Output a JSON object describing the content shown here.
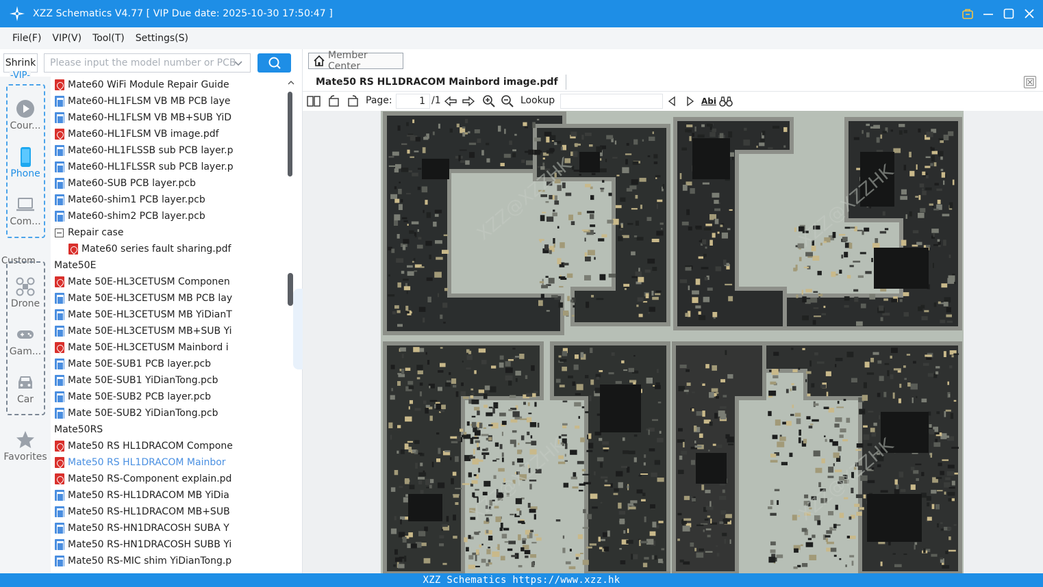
{
  "window": {
    "title": "XZZ Schematics V4.77 [ VIP Due date: 2025-10-30 17:50:47 ]",
    "accent": "#1e8ee6"
  },
  "menu": [
    "File(F)",
    "VIP(V)",
    "Tool(T)",
    "Settings(S)"
  ],
  "sidebar": {
    "shrink_label": "Shrink",
    "search_placeholder": "Please input the model number or PCB",
    "vip_label": "VIP",
    "custom_label": "Custom",
    "categories": [
      {
        "label": "Cour...",
        "icon": "play-icon"
      },
      {
        "label": "Phone",
        "icon": "phone-icon"
      },
      {
        "label": "Com...",
        "icon": "laptop-icon"
      },
      {
        "label": "Drone",
        "icon": "drone-icon"
      },
      {
        "label": "Gam...",
        "icon": "gamepad-icon"
      },
      {
        "label": "Car",
        "icon": "car-icon"
      },
      {
        "label": "Favorites",
        "icon": "star-icon"
      }
    ],
    "active_category": "Phone"
  },
  "tree": [
    {
      "type": "pdf",
      "level": 2,
      "label": "Mate60 WiFi Module Repair Guide"
    },
    {
      "type": "pcb",
      "level": 2,
      "label": "Mate60-HL1FLSM VB MB PCB laye"
    },
    {
      "type": "pcb",
      "level": 2,
      "label": "Mate60-HL1FLSM VB MB+SUB YiD"
    },
    {
      "type": "pdf",
      "level": 2,
      "label": "Mate60-HL1FLSM VB image.pdf"
    },
    {
      "type": "pcb",
      "level": 2,
      "label": "Mate60-HL1FLSSB sub PCB layer.p"
    },
    {
      "type": "pcb",
      "level": 2,
      "label": "Mate60-HL1FLSSR sub PCB layer.p"
    },
    {
      "type": "pcb",
      "level": 2,
      "label": "Mate60-SUB PCB layer.pcb"
    },
    {
      "type": "pcb",
      "level": 2,
      "label": "Mate60-shim1 PCB layer.pcb"
    },
    {
      "type": "pcb",
      "level": 2,
      "label": "Mate60-shim2 PCB layer.pcb"
    },
    {
      "type": "folder",
      "level": 2,
      "label": "Repair case"
    },
    {
      "type": "pdf",
      "level": 3,
      "label": "Mate60 series fault sharing.pdf"
    },
    {
      "type": "folder",
      "level": 1,
      "label": "Mate50E"
    },
    {
      "type": "pdf",
      "level": 2,
      "label": "Mate 50E-HL3CETUSM Componen"
    },
    {
      "type": "pcb",
      "level": 2,
      "label": "Mate 50E-HL3CETUSM MB PCB lay"
    },
    {
      "type": "pcb",
      "level": 2,
      "label": "Mate 50E-HL3CETUSM MB YiDianT"
    },
    {
      "type": "pcb",
      "level": 2,
      "label": "Mate 50E-HL3CETUSM MB+SUB Yi"
    },
    {
      "type": "pdf",
      "level": 2,
      "label": "Mate 50E-HL3CETUSM Mainbord i"
    },
    {
      "type": "pcb",
      "level": 2,
      "label": "Mate 50E-SUB1 PCB layer.pcb"
    },
    {
      "type": "pcb",
      "level": 2,
      "label": "Mate 50E-SUB1 YiDianTong.pcb"
    },
    {
      "type": "pcb",
      "level": 2,
      "label": "Mate 50E-SUB2 PCB layer.pcb"
    },
    {
      "type": "pcb",
      "level": 2,
      "label": "Mate 50E-SUB2 YiDianTong.pcb"
    },
    {
      "type": "folder",
      "level": 1,
      "label": "Mate50RS"
    },
    {
      "type": "pdf",
      "level": 2,
      "label": "Mate50 RS HL1DRACOM Compone"
    },
    {
      "type": "pdf",
      "level": 2,
      "label": "Mate50 RS HL1DRACOM Mainbor",
      "selected": true
    },
    {
      "type": "pdf",
      "level": 2,
      "label": "Mate50 RS-Component explain.pd"
    },
    {
      "type": "pcb",
      "level": 2,
      "label": "Mate50 RS-HL1DRACOM MB YiDia"
    },
    {
      "type": "pcb",
      "level": 2,
      "label": "Mate50 RS-HL1DRACOM MB+SUB"
    },
    {
      "type": "pcb",
      "level": 2,
      "label": "Mate50 RS-HN1DRACOSH SUBA Y"
    },
    {
      "type": "pcb",
      "level": 2,
      "label": "Mate50 RS-HN1DRACOSH SUBB Yi"
    },
    {
      "type": "pcb",
      "level": 2,
      "label": "Mate50 RS-MIC shim YiDianTong.p"
    }
  ],
  "viewer": {
    "member_center": "Member Center",
    "tab_label": "Mate50 RS HL1DRACOM Mainbord image.pdf",
    "page_label": "Page:",
    "page_value": "1",
    "page_total": "/1",
    "lookup_label": "Lookup",
    "lookup_value": "",
    "abi_label": "Abi"
  },
  "status": {
    "text": "XZZ Schematics https://www.xzz.hk"
  }
}
